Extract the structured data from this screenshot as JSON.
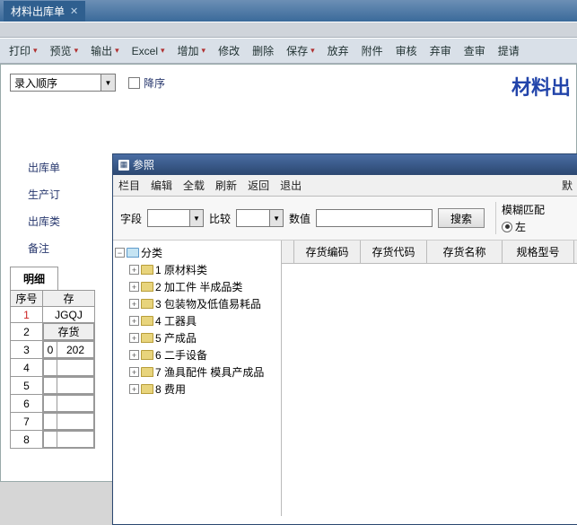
{
  "tab_title": "材料出库单",
  "menu": [
    "打印",
    "预览",
    "输出",
    "Excel",
    "增加",
    "修改",
    "删除",
    "保存",
    "放弃",
    "附件",
    "审核",
    "弃审",
    "查审",
    "提请"
  ],
  "form": {
    "entry_mode": "录入顺序",
    "desc_label": "降序",
    "big_title": "材料出",
    "labels": {
      "l1": "出库单",
      "l2": "生产订",
      "l3": "出库类",
      "l4": "备注"
    }
  },
  "detail": {
    "tab": "明细",
    "cols": {
      "seq": "序号",
      "inv": "存",
      "sub_inv": "存货"
    },
    "rows": [
      {
        "n": 1,
        "v": "JGQJ"
      },
      {
        "n": 2,
        "v": ""
      },
      {
        "n": 3,
        "v": "0"
      },
      {
        "n": 4,
        "v": ""
      },
      {
        "n": 5,
        "v": ""
      },
      {
        "n": 6,
        "v": ""
      },
      {
        "n": 7,
        "v": ""
      },
      {
        "n": 8,
        "v": ""
      }
    ],
    "sub_year": "202"
  },
  "popup": {
    "title": "参照",
    "menu": [
      "栏目",
      "编辑",
      "全载",
      "刷新",
      "返回",
      "退出"
    ],
    "menu_right": "默",
    "search": {
      "field_lbl": "字段",
      "compare_lbl": "比较",
      "value_lbl": "数值",
      "btn": "搜索",
      "fuzzy_lbl": "模糊匹配",
      "left_lbl": "左"
    },
    "columns": [
      "存货编码",
      "存货代码",
      "存货名称",
      "规格型号"
    ],
    "tree": {
      "root": "分类",
      "items": [
        {
          "n": "1",
          "t": "原材料类"
        },
        {
          "n": "2",
          "t": "加工件 半成品类"
        },
        {
          "n": "3",
          "t": "包装物及低值易耗品"
        },
        {
          "n": "4",
          "t": "工器具"
        },
        {
          "n": "5",
          "t": "产成品"
        },
        {
          "n": "6",
          "t": "二手设备"
        },
        {
          "n": "7",
          "t": "渔具配件  模具产成品"
        },
        {
          "n": "8",
          "t": "费用"
        }
      ]
    }
  }
}
